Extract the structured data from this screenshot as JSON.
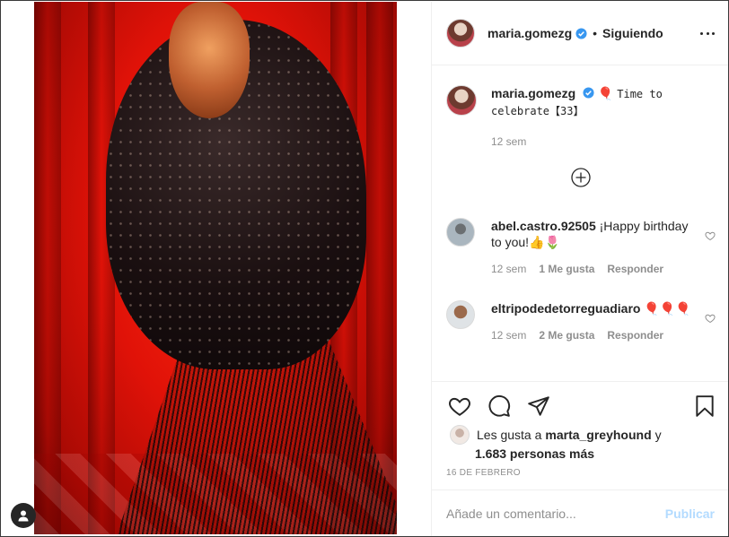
{
  "post": {
    "author": "maria.gomezg",
    "follow_status": "Siguiendo",
    "separator": "•",
    "caption_text": "Time to celebrate【33】",
    "caption_emoji": "🎈",
    "caption_time": "12 sem"
  },
  "comments": [
    {
      "user": "abel.castro.92505",
      "text": "¡Happy birthday to you!👍🌷",
      "time": "12 sem",
      "likes": "1 Me gusta",
      "reply": "Responder"
    },
    {
      "user": "eltripodedetorreguadiaro",
      "text": "🎈🎈🎈",
      "time": "12 sem",
      "likes": "2 Me gusta",
      "reply": "Responder"
    }
  ],
  "likes": {
    "prefix": "Les gusta a",
    "user": "marta_greyhound",
    "connector": "y",
    "others": "1.683 personas más"
  },
  "date": "16 DE FEBRERO",
  "add_comment": {
    "placeholder": "Añade un comentario...",
    "publish": "Publicar"
  },
  "icons": {
    "header": [
      "verified-badge",
      "more-options"
    ],
    "actions": [
      "heart-icon",
      "comment-icon",
      "share-icon",
      "bookmark-icon"
    ],
    "misc": [
      "load-more-icon",
      "profile-icon"
    ]
  },
  "colors": {
    "verified": "#3897f0",
    "publish_disabled": "#b3dbff",
    "muted": "#8e8e8e"
  }
}
